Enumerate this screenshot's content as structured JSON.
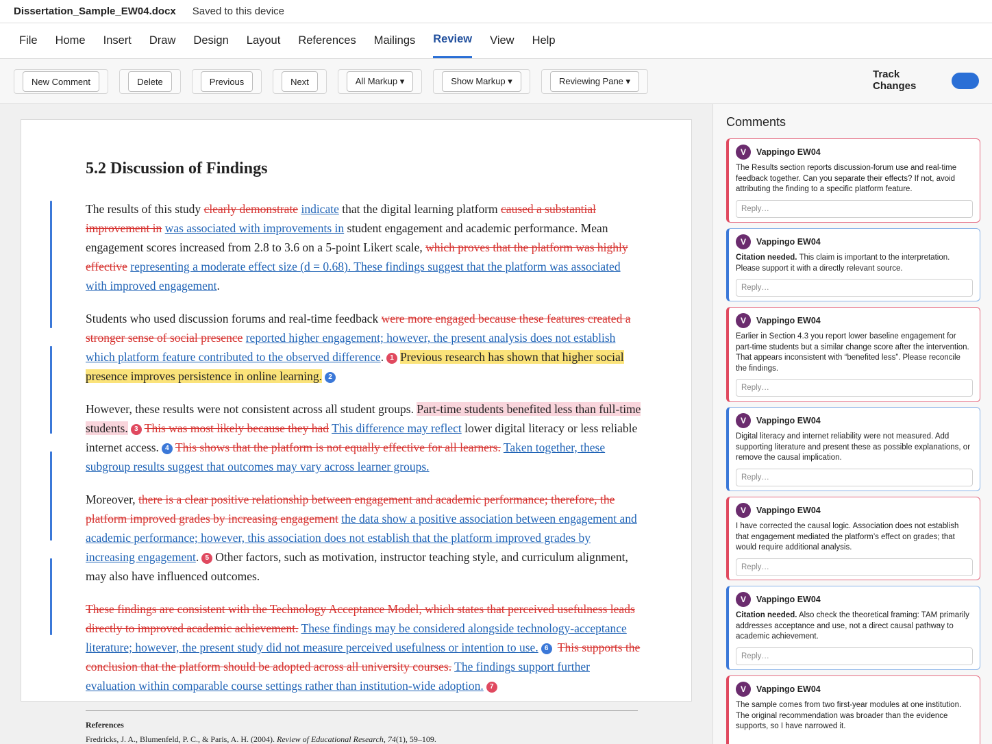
{
  "window": {
    "doc_name": "Dissertation_Sample_EW04.docx",
    "save_status": "Saved to this device"
  },
  "menu": {
    "tabs": [
      "File",
      "Home",
      "Insert",
      "Draw",
      "Design",
      "Layout",
      "References",
      "Mailings",
      "Review",
      "View",
      "Help"
    ],
    "active": "Review"
  },
  "ribbon": {
    "new_comment": "New Comment",
    "delete": "Delete",
    "previous": "Previous",
    "next": "Next",
    "all_markup": "All Markup ▾",
    "show_markup": "Show Markup ▾",
    "reviewing_pane": "Reviewing Pane ▾",
    "track_changes_line1": "Track",
    "track_changes_line2": "Changes",
    "track_changes_on": true
  },
  "colors": {
    "deleted": "#d6322f",
    "inserted": "#1f63b6",
    "accent": "#2a6fd6",
    "highlight_yellow": "#fbe37a",
    "highlight_pink": "#f9d5dc"
  },
  "document": {
    "heading": "5.2 Discussion of Findings",
    "p1": {
      "t1": "The results of this study ",
      "d1": "clearly demonstrate",
      "i1": "indicate",
      "t2": " that the digital learning platform ",
      "d2": "caused a substantial improvement in",
      "i2": "was associated with improvements in",
      "t3": " student engagement and academic performance. Mean engagement scores increased from 2.8 to 3.6 on a 5-point Likert scale, ",
      "d3": "which proves that the platform was highly effective",
      "i3": "representing a moderate effect size (d = 0.68). These findings suggest that the platform was associated with improved engagement",
      "t4": "."
    },
    "p2": {
      "t1": "Students who used discussion forums and real-time feedback ",
      "d1": "were more engaged because these features created a stronger sense of social presence",
      "i1": "reported higher engagement; however, the present analysis does not establish which platform feature contributed to the observed difference",
      "t2": ".",
      "b1": "1",
      "h1": "Previous research has shown that higher social presence improves persistence in online learning.",
      "b2": "2"
    },
    "p3": {
      "t1": "However, these results were not consistent across all student groups. ",
      "h1": "Part-time students benefited less than full-time students.",
      "b3": "3",
      "d1": "This was most likely because they had",
      "i1": "This difference may reflect",
      "t2": " lower digital literacy or less reliable internet access.",
      "b4": "4",
      "d2": "This shows that the platform is not equally effective for all learners.",
      "i2": "Taken together, these subgroup results suggest that outcomes may vary across learner groups."
    },
    "p4": {
      "t1": "Moreover, ",
      "d1": "there is a clear positive relationship between engagement and academic performance; therefore, the platform improved grades by increasing engagement",
      "i1": "the data show a positive association between engagement and academic performance; however, this association does not establish that the platform improved grades by increasing engagement",
      "t2": ".",
      "b5": "5",
      "t3": "Other factors, such as motivation, instructor teaching style, and curriculum alignment, may also have influenced outcomes."
    },
    "p5": {
      "d1": "These findings are consistent with the Technology Acceptance Model, which states that perceived usefulness leads directly to improved academic achievement.",
      "i1": "These findings may be considered alongside technology-acceptance literature; however, the present study did not measure perceived usefulness or intention to use.",
      "b6": "6",
      "d2": "This supports the conclusion that the platform should be adopted across all university courses.",
      "i2": "The findings support further evaluation within comparable course settings rather than institution-wide adoption.",
      "b7": "7"
    },
    "references": {
      "title": "References",
      "entry_authors": "Fredricks, J. A., Blumenfeld, P. C., & Paris, A. H. (2004). ",
      "entry_journal": "Review of Educational Research, 74",
      "entry_rest": "(1), 59–109."
    }
  },
  "comments": {
    "title": "Comments",
    "reply_placeholder": "Reply…",
    "items": [
      {
        "initial": "V",
        "author": "Vappingo EW04",
        "bold": "",
        "text": "The Results section reports discussion-forum use and real-time feedback together. Can you separate their effects? If not, avoid attributing the finding to a specific platform feature."
      },
      {
        "initial": "V",
        "author": "Vappingo EW04",
        "bold": "Citation needed.",
        "text": " This claim is important to the interpretation. Please support it with a directly relevant source."
      },
      {
        "initial": "V",
        "author": "Vappingo EW04",
        "bold": "",
        "text": "Earlier in Section 4.3 you report lower baseline engagement for part-time students but a similar change score after the intervention. That appears inconsistent with “benefited less”. Please reconcile the findings."
      },
      {
        "initial": "V",
        "author": "Vappingo EW04",
        "bold": "",
        "text": "Digital literacy and internet reliability were not measured. Add supporting literature and present these as possible explanations, or remove the causal implication."
      },
      {
        "initial": "V",
        "author": "Vappingo EW04",
        "bold": "",
        "text": "I have corrected the causal logic. Association does not establish that engagement mediated the platform’s effect on grades; that would require additional analysis."
      },
      {
        "initial": "V",
        "author": "Vappingo EW04",
        "bold": "Citation needed.",
        "text": " Also check the theoretical framing: TAM primarily addresses acceptance and use, not a direct causal pathway to academic achievement."
      },
      {
        "initial": "V",
        "author": "Vappingo EW04",
        "bold": "",
        "text": "The sample comes from two first-year modules at one institution. The original recommendation was broader than the evidence supports, so I have narrowed it."
      }
    ]
  }
}
